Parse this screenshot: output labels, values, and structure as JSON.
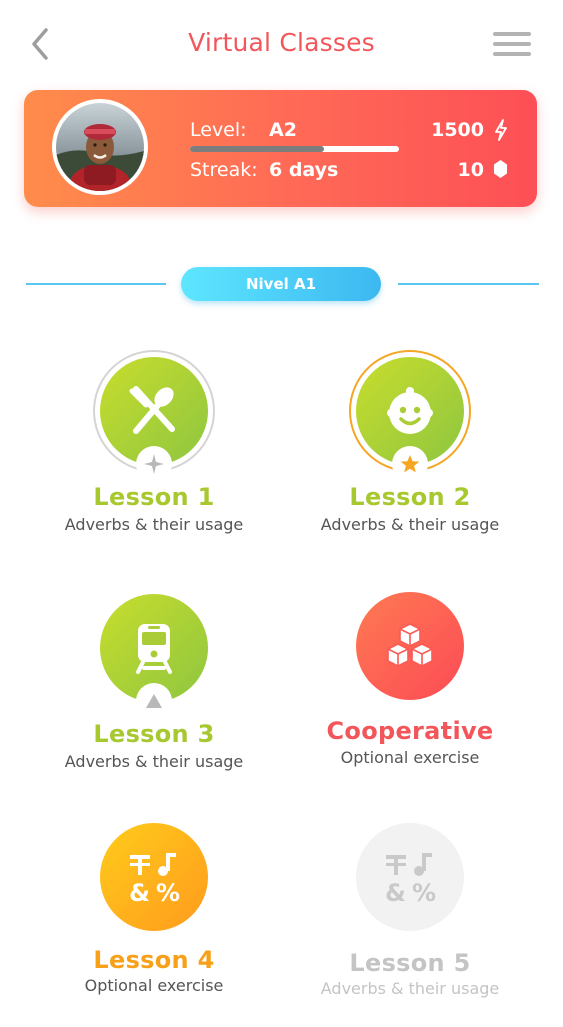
{
  "header": {
    "title": "Virtual Classes",
    "back_icon": "chevron-left-icon",
    "menu_icon": "hamburger-menu-icon"
  },
  "profile": {
    "level_label": "Level:",
    "level_value": "A2",
    "level_progress": 0.64,
    "streak_label": "Streak:",
    "streak_value": "6 days",
    "xp": "1500",
    "xp_icon": "lightning-icon",
    "gems": "10",
    "gem_icon": "gem-icon"
  },
  "level_banner": {
    "label": "Nivel A1"
  },
  "lessons": [
    {
      "name": "Lesson 1",
      "desc": "Adverbs & their usage",
      "icon": "utensils-icon",
      "badge": "sparkle-icon"
    },
    {
      "name": "Lesson 2",
      "desc": "Adverbs & their usage",
      "icon": "baby-face-icon",
      "badge": "star-icon"
    },
    {
      "name": "Lesson 3",
      "desc": "Adverbs & their usage",
      "icon": "train-icon",
      "badge": "triangle-icon"
    },
    {
      "name": "Cooperative",
      "desc": "Optional exercise",
      "icon": "cubes-icon"
    },
    {
      "name": "Lesson 4",
      "desc": "Optional exercise",
      "icon": "symbols-icon"
    },
    {
      "name": "Lesson 5",
      "desc": "Adverbs & their usage",
      "icon": "symbols-icon"
    }
  ],
  "colors": {
    "accent_red": "#f2565a",
    "green": "#a7c82f",
    "orange": "#f7a11a",
    "blue": "#3cb8f0",
    "locked_grey": "#c4c4c4"
  }
}
